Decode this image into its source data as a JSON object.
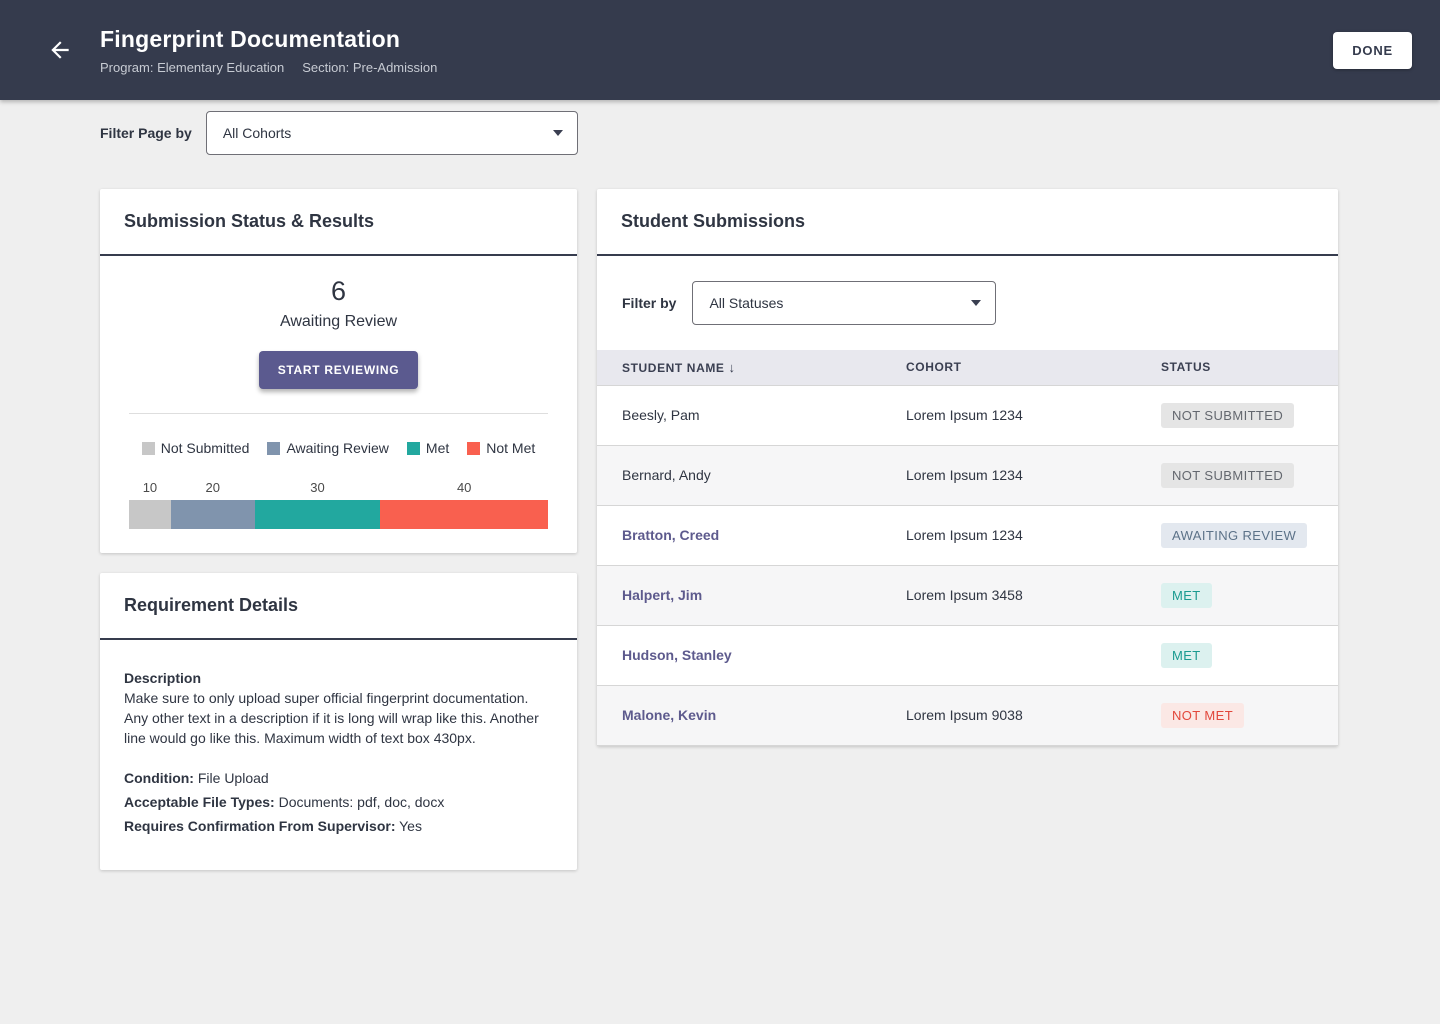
{
  "header": {
    "title": "Fingerprint Documentation",
    "subtitle_program": "Program: Elementary Education",
    "subtitle_section": "Section: Pre-Admission",
    "done_label": "DONE"
  },
  "filter_bar": {
    "label": "Filter Page by",
    "dropdown_value": "All Cohorts"
  },
  "status_card": {
    "title": "Submission Status & Results",
    "count": "6",
    "count_label": "Awaiting Review",
    "button_label": "START REVIEWING",
    "legend": [
      {
        "label": "Not Submitted",
        "color": "#C7C7C7"
      },
      {
        "label": "Awaiting Review",
        "color": "#8094AD"
      },
      {
        "label": "Met",
        "color": "#22A89F"
      },
      {
        "label": "Not Met",
        "color": "#F9604F"
      }
    ],
    "chart_data": {
      "type": "bar",
      "stacked": true,
      "categories": [
        "Not Submitted",
        "Awaiting Review",
        "Met",
        "Not Met"
      ],
      "values": [
        10,
        20,
        30,
        40
      ],
      "colors": [
        "#C7C7C7",
        "#8094AD",
        "#22A89F",
        "#F9604F"
      ],
      "title": "Submission Status & Results",
      "xlabel": "",
      "ylabel": "",
      "legend_position": "top"
    }
  },
  "requirement_card": {
    "title": "Requirement Details",
    "description_label": "Description",
    "description_text": "Make sure to only upload super official fingerprint documentation. Any other text in a description if it is long will wrap like this. Another line would go like this. Maximum width of text box 430px.",
    "fields": [
      {
        "label": "Condition:",
        "value": "File Upload"
      },
      {
        "label": "Acceptable File Types:",
        "value": "Documents: pdf, doc, docx"
      },
      {
        "label": "Requires Confirmation From Supervisor:",
        "value": "Yes"
      }
    ]
  },
  "submissions_card": {
    "title": "Student Submissions",
    "filter_label": "Filter by",
    "filter_value": "All Statuses",
    "columns": [
      "STUDENT NAME",
      "COHORT",
      "STATUS"
    ],
    "sort_icon": "↓",
    "rows": [
      {
        "name": "Beesly, Pam",
        "cohort": "Lorem Ipsum 1234",
        "status": "NOT SUBMITTED",
        "status_type": "not-submitted",
        "link": false
      },
      {
        "name": "Bernard, Andy",
        "cohort": "Lorem Ipsum 1234",
        "status": "NOT SUBMITTED",
        "status_type": "not-submitted",
        "link": false
      },
      {
        "name": "Bratton, Creed",
        "cohort": "Lorem Ipsum 1234",
        "status": "AWAITING REVIEW",
        "status_type": "awaiting-review",
        "link": true
      },
      {
        "name": "Halpert, Jim",
        "cohort": "Lorem Ipsum 3458",
        "status": "MET",
        "status_type": "met",
        "link": true
      },
      {
        "name": "Hudson, Stanley",
        "cohort": "",
        "status": "MET",
        "status_type": "met",
        "link": true
      },
      {
        "name": "Malone, Kevin",
        "cohort": "Lorem Ipsum 9038",
        "status": "NOT MET",
        "status_type": "not-met",
        "link": true
      }
    ]
  }
}
